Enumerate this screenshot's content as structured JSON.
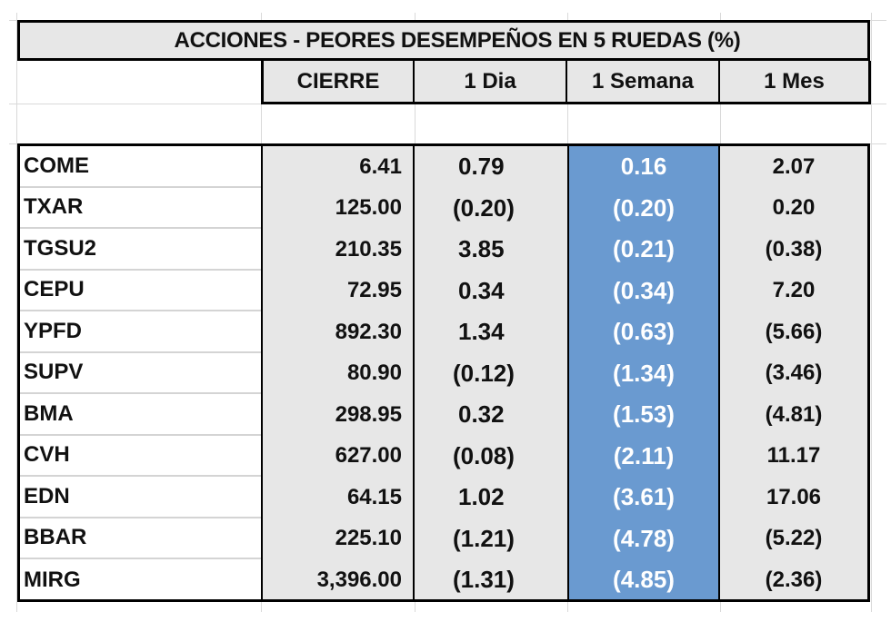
{
  "title": "ACCIONES   - PEORES DESEMPEÑOS EN 5 RUEDAS (%)",
  "columns": [
    "CIERRE",
    "1 Dia",
    "1 Semana",
    "1 Mes"
  ],
  "colors": {
    "header_bg": "#e7e7e7",
    "highlight_column_bg": "#6a9ad0",
    "highlight_text": "#ffffff"
  },
  "rows": [
    {
      "ticker": "COME",
      "cierre": "6.41",
      "dia": "0.79",
      "semana": "0.16",
      "mes": "2.07"
    },
    {
      "ticker": "TXAR",
      "cierre": "125.00",
      "dia": "(0.20)",
      "semana": "(0.20)",
      "mes": "0.20"
    },
    {
      "ticker": "TGSU2",
      "cierre": "210.35",
      "dia": "3.85",
      "semana": "(0.21)",
      "mes": "(0.38)"
    },
    {
      "ticker": "CEPU",
      "cierre": "72.95",
      "dia": "0.34",
      "semana": "(0.34)",
      "mes": "7.20"
    },
    {
      "ticker": "YPFD",
      "cierre": "892.30",
      "dia": "1.34",
      "semana": "(0.63)",
      "mes": "(5.66)"
    },
    {
      "ticker": "SUPV",
      "cierre": "80.90",
      "dia": "(0.12)",
      "semana": "(1.34)",
      "mes": "(3.46)"
    },
    {
      "ticker": "BMA",
      "cierre": "298.95",
      "dia": "0.32",
      "semana": "(1.53)",
      "mes": "(4.81)"
    },
    {
      "ticker": "CVH",
      "cierre": "627.00",
      "dia": "(0.08)",
      "semana": "(2.11)",
      "mes": "11.17"
    },
    {
      "ticker": "EDN",
      "cierre": "64.15",
      "dia": "1.02",
      "semana": "(3.61)",
      "mes": "17.06"
    },
    {
      "ticker": "BBAR",
      "cierre": "225.10",
      "dia": "(1.21)",
      "semana": "(4.78)",
      "mes": "(5.22)"
    },
    {
      "ticker": "MIRG",
      "cierre": "3,396.00",
      "dia": "(1.31)",
      "semana": "(4.85)",
      "mes": "(2.36)"
    }
  ]
}
